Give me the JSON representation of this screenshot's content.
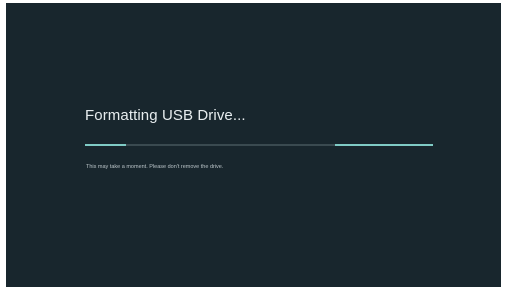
{
  "dialog": {
    "title": "Formatting USB Drive...",
    "message": "This may take a moment. Please don't remove the drive.",
    "progress": "indeterminate",
    "colors": {
      "background": "#18262d",
      "accent": "#7fcbc5",
      "track": "#3a4a50",
      "title_text": "#e6ecee",
      "message_text": "#b8c2c6"
    }
  }
}
